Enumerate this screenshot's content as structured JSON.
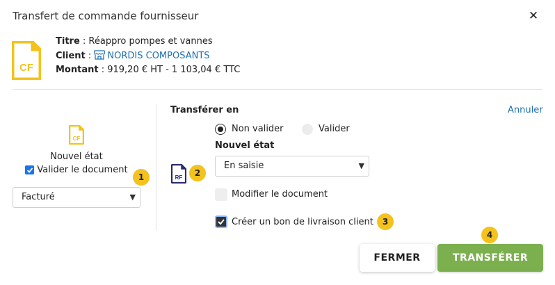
{
  "dialog": {
    "title": "Transfert de commande fournisseur",
    "close_icon": "close-icon"
  },
  "source_document": {
    "icon_label": "CF",
    "icon_color": "#f4c21c",
    "title_label": "Titre",
    "title_value": " : Réappro pompes et vannes",
    "client_label": "Client",
    "client_sep": " : ",
    "client_icon": "store-icon",
    "client_value": "NORDIS COMPOSANTS",
    "amount_label": "Montant",
    "amount_value": " : 919,20 € HT - 1 103,04 € TTC"
  },
  "left_panel": {
    "icon_label": "CF",
    "state_label": "Nouvel état",
    "validate_label": "Valider le document",
    "validate_checked": true,
    "state_select_value": "Facturé",
    "badge": "1"
  },
  "transfer": {
    "section_title": "Transférer en",
    "cancel_link": "Annuler",
    "target_icon_label": "RF",
    "target_icon_color": "#2a2a6e",
    "badge": "2",
    "radio_options": [
      {
        "label": "Non valider",
        "selected": true
      },
      {
        "label": "Valider",
        "selected": false
      }
    ],
    "state_label": "Nouvel état",
    "state_select_value": "En saisie",
    "modify_label": "Modifier le document",
    "modify_checked": false,
    "create_delivery_label": "Créer un bon de livraison client",
    "create_delivery_checked": true,
    "badge3": "3"
  },
  "footer": {
    "close_button": "FERMER",
    "transfer_button": "TRANSFÉRER",
    "badge4": "4",
    "accent_color": "#7cb04f",
    "badge_color": "#f4c21c",
    "link_color": "#1f6fb2"
  }
}
